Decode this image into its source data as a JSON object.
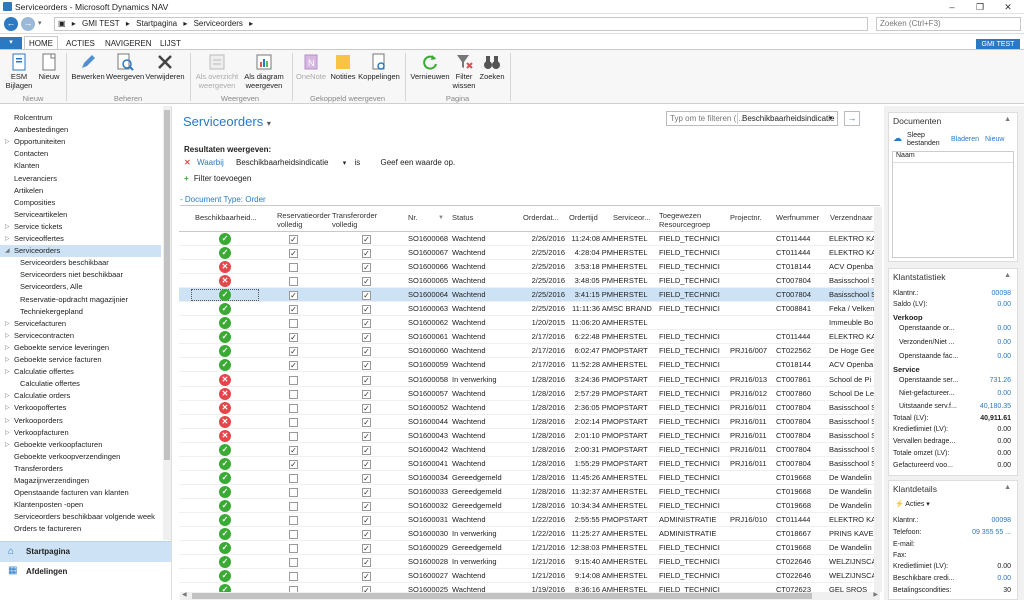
{
  "window": {
    "title": "Serviceorders - Microsoft Dynamics NAV"
  },
  "address": {
    "crumbs": [
      "GMI TEST",
      "Startpagina",
      "Serviceorders"
    ],
    "search_placeholder": "Zoeken (Ctrl+F3)"
  },
  "tabs": [
    "HOME",
    "ACTIES",
    "NAVIGEREN",
    "LIJST"
  ],
  "company_badge": "GMI TEST",
  "ribbon": {
    "groups": [
      "Nieuw",
      "Beheren",
      "Weergeven",
      "Gekoppeld weergeven",
      "Pagina"
    ],
    "buttons": {
      "esm": "ESM Bijlagen",
      "nieuw": "Nieuw",
      "bewerken": "Bewerken",
      "weergeven": "Weergeven",
      "verwijderen": "Verwijderen",
      "overzicht": "Als overzicht weergeven",
      "diagram": "Als diagram weergeven",
      "onenote": "OneNote",
      "notities": "Notities",
      "koppelingen": "Koppelingen",
      "vernieuwen": "Vernieuwen",
      "filterwissen": "Filter wissen",
      "zoeken": "Zoeken"
    }
  },
  "nav": {
    "items": [
      {
        "label": "Rolcentrum",
        "level": 0
      },
      {
        "label": "Aanbestedingen",
        "level": 0
      },
      {
        "label": "Opportuniteiten",
        "level": 0,
        "arrow": true
      },
      {
        "label": "Contacten",
        "level": 0
      },
      {
        "label": "Klanten",
        "level": 0
      },
      {
        "label": "Leveranciers",
        "level": 0
      },
      {
        "label": "Artikelen",
        "level": 0
      },
      {
        "label": "Composities",
        "level": 0
      },
      {
        "label": "Serviceartikelen",
        "level": 0
      },
      {
        "label": "Service tickets",
        "level": 0,
        "arrow": true
      },
      {
        "label": "Serviceoffertes",
        "level": 0,
        "arrow": true
      },
      {
        "label": "Serviceorders",
        "level": 0,
        "arrow": true,
        "selected": true
      },
      {
        "label": "Serviceorders beschikbaar",
        "level": 1
      },
      {
        "label": "Serviceorders niet beschikbaar",
        "level": 1
      },
      {
        "label": "Serviceorders, Alle",
        "level": 1
      },
      {
        "label": "Reservatie-opdracht magazijnier",
        "level": 1
      },
      {
        "label": "Techniekergepland",
        "level": 1
      },
      {
        "label": "Servicefacturen",
        "level": 0,
        "arrow": true
      },
      {
        "label": "Servicecontracten",
        "level": 0,
        "arrow": true
      },
      {
        "label": "Geboekte service leveringen",
        "level": 0,
        "arrow": true
      },
      {
        "label": "Geboekte service facturen",
        "level": 0,
        "arrow": true
      },
      {
        "label": "Calculatie offertes",
        "level": 0,
        "arrow": true
      },
      {
        "label": "Calculatie offertes",
        "level": 1
      },
      {
        "label": "Calculatie orders",
        "level": 0,
        "arrow": true
      },
      {
        "label": "Verkoopoffertes",
        "level": 0,
        "arrow": true
      },
      {
        "label": "Verkooporders",
        "level": 0,
        "arrow": true
      },
      {
        "label": "Verkoopfacturen",
        "level": 0,
        "arrow": true
      },
      {
        "label": "Geboekte verkoopfacturen",
        "level": 0,
        "arrow": true
      },
      {
        "label": "Geboekte verkoopverzendingen",
        "level": 0
      },
      {
        "label": "Transferorders",
        "level": 0
      },
      {
        "label": "Magazijnverzendingen",
        "level": 0
      },
      {
        "label": "Openstaande facturen van klanten",
        "level": 0
      },
      {
        "label": "Klantenposten -open",
        "level": 0
      },
      {
        "label": "Serviceorders beschikbaar volgende week",
        "level": 0
      },
      {
        "label": "Orders te factureren",
        "level": 0
      }
    ],
    "start": "Startpagina",
    "afdelingen": "Afdelingen"
  },
  "main": {
    "title": "Serviceorders",
    "filter_placeholder": "Typ om te filteren (...",
    "filter_field": "Beschikbaarheidsindicatie",
    "results_header": "Resultaten weergeven:",
    "where": "Waarbij",
    "field": "Beschikbaarheidsindicatie",
    "op": "is",
    "value": "Geef een waarde op.",
    "add_filter": "Filter toevoegen",
    "doc_type": "Document Type: Order"
  },
  "grid": {
    "columns": [
      "Beschikbaarheid...",
      "Reservatieorder volledig",
      "Transferorder volledig",
      "Nr.",
      "Status",
      "Orderdat...",
      "Ordertijd",
      "Serviceor...",
      "Toegewezen Resourcegroep",
      "Projectnr.",
      "Werfnummer",
      "Verzendnaar"
    ],
    "rows": [
      {
        "a": "ok",
        "r": true,
        "t": true,
        "nr": "SO1600068",
        "st": "Wachtend",
        "d": "2/26/2016",
        "tm": "11:24:08 AM",
        "so": "HERSTEL",
        "rg": "FIELD_TECHNICI",
        "pj": "",
        "wf": "CT011444",
        "vz": "ELEKTRO KA"
      },
      {
        "a": "ok",
        "r": true,
        "t": true,
        "nr": "SO1600067",
        "st": "Wachtend",
        "d": "2/25/2016",
        "tm": "4:28:04 PM",
        "so": "HERSTEL",
        "rg": "FIELD_TECHNICI",
        "pj": "",
        "wf": "CT011444",
        "vz": "ELEKTRO KA"
      },
      {
        "a": "no",
        "r": false,
        "t": true,
        "nr": "SO1600066",
        "st": "Wachtend",
        "d": "2/25/2016",
        "tm": "3:53:18 PM",
        "so": "HERSTEL",
        "rg": "FIELD_TECHNICI",
        "pj": "",
        "wf": "CT018144",
        "vz": "ACV Openba"
      },
      {
        "a": "no",
        "r": false,
        "t": true,
        "nr": "SO1600065",
        "st": "Wachtend",
        "d": "2/25/2016",
        "tm": "3:48:05 PM",
        "so": "HERSTEL",
        "rg": "FIELD_TECHNICI",
        "pj": "",
        "wf": "CT007804",
        "vz": "Basisschool S"
      },
      {
        "a": "ok",
        "r": true,
        "t": true,
        "nr": "SO1600064",
        "st": "Wachtend",
        "d": "2/25/2016",
        "tm": "3:41:15 PM",
        "so": "HERSTEL",
        "rg": "FIELD_TECHNICI",
        "pj": "",
        "wf": "CT007804",
        "vz": "Basisschool S",
        "sel": true
      },
      {
        "a": "ok",
        "r": true,
        "t": true,
        "nr": "SO1600063",
        "st": "Wachtend",
        "d": "2/25/2016",
        "tm": "11:11:36 AM",
        "so": "SC BRAND",
        "rg": "FIELD_TECHNICI",
        "pj": "",
        "wf": "CT008841",
        "vz": "Feka / Velken"
      },
      {
        "a": "ok",
        "r": false,
        "t": true,
        "nr": "SO1600062",
        "st": "Wachtend",
        "d": "1/20/2015",
        "tm": "11:06:20 AM",
        "so": "HERSTEL",
        "rg": "",
        "pj": "",
        "wf": "",
        "vz": "Immeuble Bo"
      },
      {
        "a": "ok",
        "r": true,
        "t": true,
        "nr": "SO1600061",
        "st": "Wachtend",
        "d": "2/17/2016",
        "tm": "6:22:48 PM",
        "so": "HERSTEL",
        "rg": "FIELD_TECHNICI",
        "pj": "",
        "wf": "CT011444",
        "vz": "ELEKTRO KA"
      },
      {
        "a": "ok",
        "r": true,
        "t": true,
        "nr": "SO1600060",
        "st": "Wachtend",
        "d": "2/17/2016",
        "tm": "6:02:47 PM",
        "so": "OPSTART",
        "rg": "FIELD_TECHNICI",
        "pj": "PRJ16/007",
        "wf": "CT022562",
        "vz": "De Hoge Gee"
      },
      {
        "a": "ok",
        "r": true,
        "t": true,
        "nr": "SO1600059",
        "st": "Wachtend",
        "d": "2/17/2016",
        "tm": "11:52:28 AM",
        "so": "HERSTEL",
        "rg": "FIELD_TECHNICI",
        "pj": "",
        "wf": "CT018144",
        "vz": "ACV Openba"
      },
      {
        "a": "no",
        "r": false,
        "t": true,
        "nr": "SO1600058",
        "st": "In verwerking",
        "d": "1/28/2016",
        "tm": "3:24:36 PM",
        "so": "OPSTART",
        "rg": "FIELD_TECHNICI",
        "pj": "PRJ16/013",
        "wf": "CT007861",
        "vz": "School de Pi"
      },
      {
        "a": "no",
        "r": false,
        "t": true,
        "nr": "SO1600057",
        "st": "Wachtend",
        "d": "1/28/2016",
        "tm": "2:57:29 PM",
        "so": "OPSTART",
        "rg": "FIELD_TECHNICI",
        "pj": "PRJ16/012",
        "wf": "CT007860",
        "vz": "School De Le"
      },
      {
        "a": "no",
        "r": false,
        "t": true,
        "nr": "SO1600052",
        "st": "Wachtend",
        "d": "1/28/2016",
        "tm": "2:36:05 PM",
        "so": "OPSTART",
        "rg": "FIELD_TECHNICI",
        "pj": "PRJ16/011",
        "wf": "CT007804",
        "vz": "Basisschool S"
      },
      {
        "a": "no",
        "r": false,
        "t": true,
        "nr": "SO1600044",
        "st": "Wachtend",
        "d": "1/28/2016",
        "tm": "2:02:14 PM",
        "so": "OPSTART",
        "rg": "FIELD_TECHNICI",
        "pj": "PRJ16/011",
        "wf": "CT007804",
        "vz": "Basisschool S"
      },
      {
        "a": "no",
        "r": false,
        "t": true,
        "nr": "SO1600043",
        "st": "Wachtend",
        "d": "1/28/2016",
        "tm": "2:01:10 PM",
        "so": "OPSTART",
        "rg": "FIELD_TECHNICI",
        "pj": "PRJ16/011",
        "wf": "CT007804",
        "vz": "Basisschool S"
      },
      {
        "a": "ok",
        "r": true,
        "t": true,
        "nr": "SO1600042",
        "st": "Wachtend",
        "d": "1/28/2016",
        "tm": "2:00:31 PM",
        "so": "OPSTART",
        "rg": "FIELD_TECHNICI",
        "pj": "PRJ16/011",
        "wf": "CT007804",
        "vz": "Basisschool S"
      },
      {
        "a": "ok",
        "r": true,
        "t": true,
        "nr": "SO1600041",
        "st": "Wachtend",
        "d": "1/28/2016",
        "tm": "1:55:29 PM",
        "so": "OPSTART",
        "rg": "FIELD_TECHNICI",
        "pj": "PRJ16/011",
        "wf": "CT007804",
        "vz": "Basisschool S"
      },
      {
        "a": "ok",
        "r": false,
        "t": true,
        "nr": "SO1600034",
        "st": "Gereedgemeld",
        "d": "1/28/2016",
        "tm": "11:45:26 AM",
        "so": "HERSTEL",
        "rg": "FIELD_TECHNICI",
        "pj": "",
        "wf": "CT019668",
        "vz": "De Wandelin"
      },
      {
        "a": "ok",
        "r": false,
        "t": true,
        "nr": "SO1600033",
        "st": "Gereedgemeld",
        "d": "1/28/2016",
        "tm": "11:32:37 AM",
        "so": "HERSTEL",
        "rg": "FIELD_TECHNICI",
        "pj": "",
        "wf": "CT019668",
        "vz": "De Wandelin"
      },
      {
        "a": "ok",
        "r": false,
        "t": true,
        "nr": "SO1600032",
        "st": "Gereedgemeld",
        "d": "1/28/2016",
        "tm": "10:34:34 AM",
        "so": "HERSTEL",
        "rg": "FIELD_TECHNICI",
        "pj": "",
        "wf": "CT019668",
        "vz": "De Wandelin"
      },
      {
        "a": "ok",
        "r": false,
        "t": true,
        "nr": "SO1600031",
        "st": "Wachtend",
        "d": "1/22/2016",
        "tm": "2:55:55 PM",
        "so": "OPSTART",
        "rg": "ADMINISTRATIE",
        "pj": "PRJ16/010",
        "wf": "CT011444",
        "vz": "ELEKTRO KA"
      },
      {
        "a": "ok",
        "r": false,
        "t": true,
        "nr": "SO1600030",
        "st": "In verwerking",
        "d": "1/22/2016",
        "tm": "11:25:27 AM",
        "so": "HERSTEL",
        "rg": "ADMINISTRATIE",
        "pj": "",
        "wf": "CT018667",
        "vz": "PRINS KAVEL"
      },
      {
        "a": "ok",
        "r": false,
        "t": true,
        "nr": "SO1600029",
        "st": "Gereedgemeld",
        "d": "1/21/2016",
        "tm": "12:38:03 PM",
        "so": "HERSTEL",
        "rg": "FIELD_TECHNICI",
        "pj": "",
        "wf": "CT019668",
        "vz": "De Wandelin"
      },
      {
        "a": "ok",
        "r": false,
        "t": true,
        "nr": "SO1600028",
        "st": "In verwerking",
        "d": "1/21/2016",
        "tm": "9:15:40 AM",
        "so": "HERSTEL",
        "rg": "FIELD_TECHNICI",
        "pj": "",
        "wf": "CT022646",
        "vz": "WELZIJNSCA"
      },
      {
        "a": "ok",
        "r": false,
        "t": true,
        "nr": "SO1600027",
        "st": "Wachtend",
        "d": "1/21/2016",
        "tm": "9:14:08 AM",
        "so": "HERSTEL",
        "rg": "FIELD_TECHNICI",
        "pj": "",
        "wf": "CT022646",
        "vz": "WELZIJNSCA"
      },
      {
        "a": "ok",
        "r": false,
        "t": true,
        "nr": "SO1600025",
        "st": "Wachtend",
        "d": "1/19/2016",
        "tm": "8:36:16 AM",
        "so": "HERSTEL",
        "rg": "FIELD_TECHNICI",
        "pj": "",
        "wf": "CT072623",
        "vz": "GEL SROS"
      }
    ]
  },
  "factbox": {
    "documenten": {
      "title": "Documenten",
      "drag": "Sleep bestanden",
      "bladeren": "Bladeren",
      "nieuw": "Nieuw",
      "naam": "Naam"
    },
    "stat": {
      "title": "Klantstatistiek",
      "klantnr": "Klantnr.:",
      "klantnr_v": "00098",
      "saldo": "Saldo (LV):",
      "saldo_v": "0.00",
      "verkoop": "Verkoop",
      "v1": "Openstaande or...",
      "v1v": "0.00",
      "v2": "Verzonden/Niet ...",
      "v2v": "0.00",
      "v3": "Openstaande fac...",
      "v3v": "0.00",
      "service": "Service",
      "s1": "Openstaande ser...",
      "s1v": "731.26",
      "s2": "Niet-gefactureer...",
      "s2v": "0.00",
      "s3": "Uitstaande serv.f...",
      "s3v": "40,180.35",
      "totaal": "Totaal (LV):",
      "totaal_v": "40,911.61",
      "k1": "Kredietlimiet (LV):",
      "k1v": "0.00",
      "k2": "Vervallen bedrage...",
      "k2v": "0.00",
      "k3": "Totale omzet (LV):",
      "k3v": "0.00",
      "k4": "Gefactureerd voo...",
      "k4v": "0.00"
    },
    "details": {
      "title": "Klantdetails",
      "acties": "Acties",
      "klantnr": "Klantnr.:",
      "klantnr_v": "00098",
      "tel": "Telefoon:",
      "tel_v": "09 355 55 ...",
      "email": "E-mail:",
      "fax": "Fax:",
      "kred": "Kredietlimiet (LV):",
      "kred_v": "0.00",
      "beschik": "Beschikbare credi...",
      "beschik_v": "0.00",
      "betal": "Betalingscondities:",
      "betal_v": "30"
    }
  }
}
